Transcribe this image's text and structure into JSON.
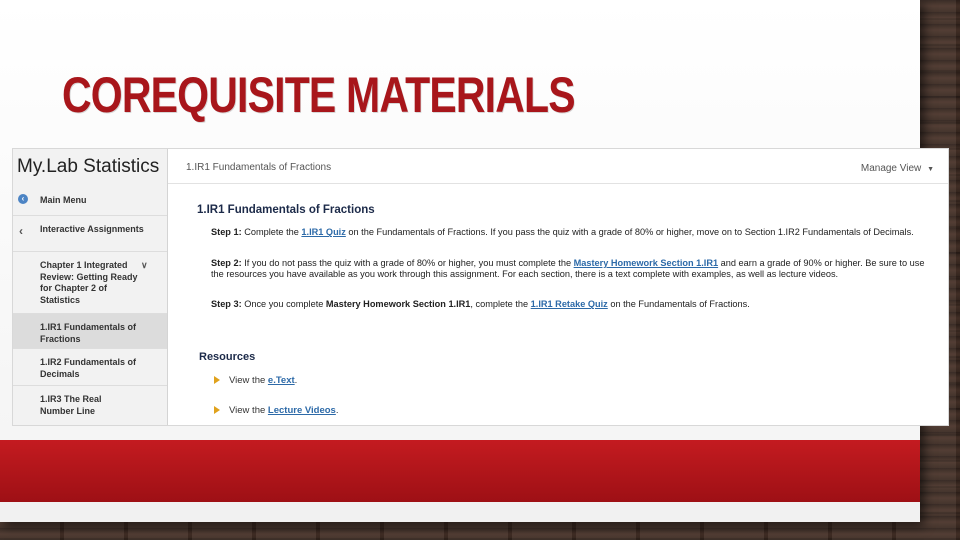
{
  "slide": {
    "title": "COREQUISITE MATERIALS"
  },
  "app": {
    "brand": "My.Lab Statistics",
    "manage_view": "Manage View",
    "breadcrumb": "1.IR1 Fundamentals of Fractions"
  },
  "sidebar": {
    "back_icon": "chevron-left-circle-icon",
    "items": [
      {
        "label": "Main Menu"
      },
      {
        "label": "Interactive Assignments"
      },
      {
        "label": "Chapter 1 Integrated Review: Getting Ready for Chapter 2 of Statistics"
      },
      {
        "label": "1.IR1 Fundamentals of Fractions"
      },
      {
        "label": "1.IR2 Fundamentals of Decimals"
      },
      {
        "label": "1.IR3 The Real Number Line"
      }
    ]
  },
  "content": {
    "heading": "1.IR1 Fundamentals of Fractions",
    "step1": {
      "label": "Step 1:",
      "t1": " Complete the ",
      "link1": "1.IR1 Quiz",
      "t2": " on the Fundamentals of Fractions. If you pass the quiz with a grade of 80% or higher, move on to Section 1.IR2 Fundamentals of Decimals."
    },
    "step2": {
      "label": "Step 2:",
      "t1": " If you do not pass the quiz with a grade of 80% or higher, you must complete the ",
      "link1": "Mastery Homework Section 1.IR1",
      "t2": " and earn a grade of 90% or higher. Be sure to use the resources you have available as you work through this assignment. For each section, there is a text complete with examples, as well as lecture videos."
    },
    "step3": {
      "label": "Step 3:",
      "t1": " Once you complete ",
      "bold1": "Mastery Homework Section 1.IR1",
      "t2": ", complete the ",
      "link1": "1.IR1 Retake Quiz",
      "t3": " on the Fundamentals of Fractions."
    },
    "resources_title": "Resources",
    "resources": [
      {
        "prefix": "View the ",
        "link": "e.Text",
        "suffix": "."
      },
      {
        "prefix": "View the ",
        "link": "Lecture Videos",
        "suffix": "."
      }
    ]
  },
  "colors": {
    "title_red": "#a8161b",
    "bar_red": "#c41b20",
    "link_blue": "#2d6aa8",
    "heading_navy": "#1c2a49",
    "bullet_gold": "#e0a21c"
  }
}
